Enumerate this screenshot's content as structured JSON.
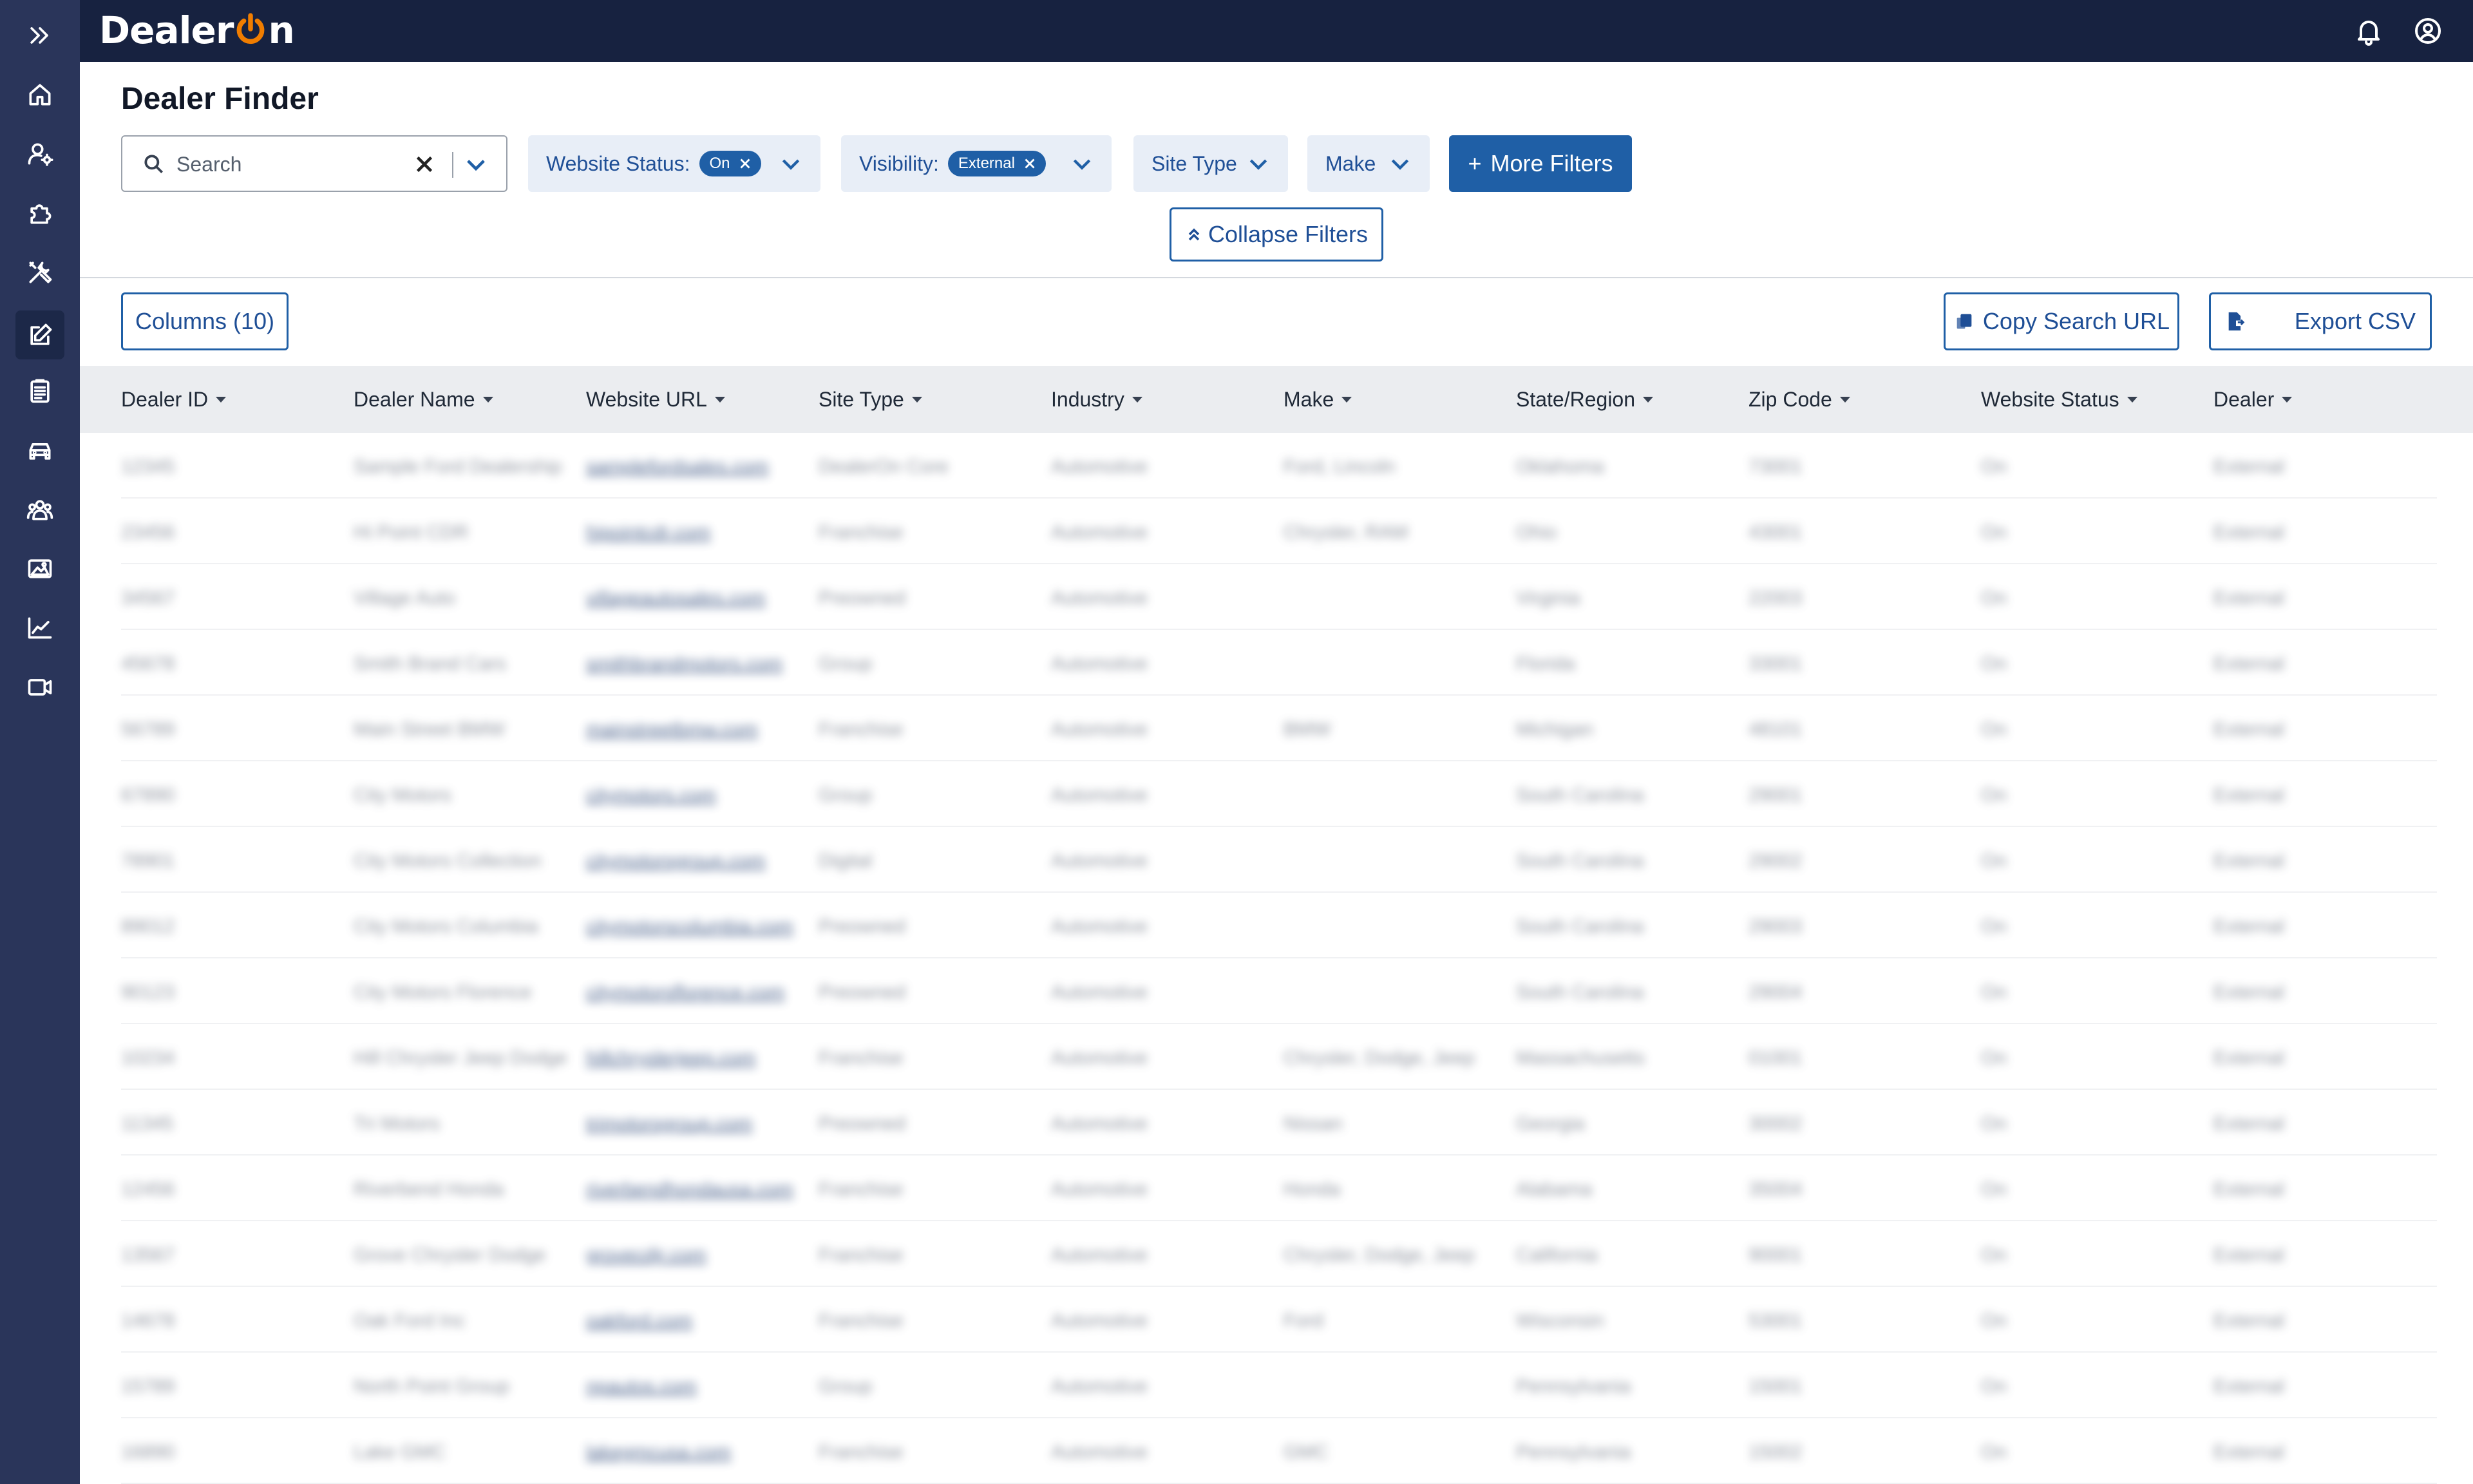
{
  "app": {
    "logo_text_1": "Dealer",
    "logo_text_2": "n",
    "colors": {
      "sidebar": "#2a355a",
      "topbar": "#172240",
      "accent": "#f07d00",
      "primary": "#1f5fa6"
    }
  },
  "sidebar": {
    "items": [
      {
        "icon": "expand-icon"
      },
      {
        "icon": "home-icon"
      },
      {
        "icon": "user-settings-icon"
      },
      {
        "icon": "puzzle-icon"
      },
      {
        "icon": "tools-icon"
      },
      {
        "icon": "edit-icon",
        "active": true
      },
      {
        "icon": "clipboard-icon"
      },
      {
        "icon": "car-icon"
      },
      {
        "icon": "users-icon"
      },
      {
        "icon": "image-icon"
      },
      {
        "icon": "chart-icon"
      },
      {
        "icon": "video-icon"
      }
    ]
  },
  "page": {
    "title": "Dealer Finder"
  },
  "filters": {
    "search_placeholder": "Search",
    "website_status": {
      "label": "Website Status:",
      "chip": "On"
    },
    "visibility": {
      "label": "Visibility:",
      "chip": "External"
    },
    "site_type": {
      "label": "Site Type"
    },
    "make": {
      "label": "Make"
    },
    "more_filters": "More Filters",
    "collapse_filters": "Collapse Filters"
  },
  "toolbar": {
    "columns": "Columns (10)",
    "copy_search_url": "Copy Search URL",
    "export_csv": "Export CSV"
  },
  "table": {
    "columns": [
      "Dealer ID",
      "Dealer Name",
      "Website URL",
      "Site Type",
      "Industry",
      "Make",
      "State/Region",
      "Zip Code",
      "Website Status",
      "Dealer"
    ],
    "rows": [
      [
        "12345",
        "Sample Ford Dealership",
        "samplefordsales.com",
        "DealerOn Core",
        "Automotive",
        "Ford, Lincoln",
        "Oklahoma",
        "73001",
        "On",
        "External"
      ],
      [
        "23456",
        "Hi Point CDR",
        "hipointcdr.com",
        "Franchise",
        "Automotive",
        "Chrysler, RAM",
        "Ohio",
        "43001",
        "On",
        "External"
      ],
      [
        "34567",
        "Village Auto",
        "villageautosales.com",
        "Preowned",
        "Automotive",
        "",
        "Virginia",
        "22003",
        "On",
        "External"
      ],
      [
        "45678",
        "Smith Brand Cars",
        "smithbrandmotors.com",
        "Group",
        "Automotive",
        "",
        "Florida",
        "33001",
        "On",
        "External"
      ],
      [
        "56789",
        "Main Street BMW",
        "mainstreetbmw.com",
        "Franchise",
        "Automotive",
        "BMW",
        "Michigan",
        "48101",
        "On",
        "External"
      ],
      [
        "67890",
        "City Motors",
        "citymotors.com",
        "Group",
        "Automotive",
        "",
        "South Carolina",
        "29001",
        "On",
        "External"
      ],
      [
        "78901",
        "City Motors Collection",
        "citymotorsgroup.com",
        "Digital",
        "Automotive",
        "",
        "South Carolina",
        "29002",
        "On",
        "External"
      ],
      [
        "89012",
        "City Motors Columbia",
        "citymotorscolumbia.com",
        "Preowned",
        "Automotive",
        "",
        "South Carolina",
        "29003",
        "On",
        "External"
      ],
      [
        "90123",
        "City Motors Florence",
        "citymotorsflorence.com",
        "Preowned",
        "Automotive",
        "",
        "South Carolina",
        "29004",
        "On",
        "External"
      ],
      [
        "10234",
        "Hill Chrysler Jeep Dodge",
        "hillchryslerjeep.com",
        "Franchise",
        "Automotive",
        "Chrysler, Dodge, Jeep",
        "Massachusetts",
        "01001",
        "On",
        "External"
      ],
      [
        "11345",
        "Tri Motors",
        "trimotorsgroup.com",
        "Preowned",
        "Automotive",
        "Nissan",
        "Georgia",
        "30002",
        "On",
        "External"
      ],
      [
        "12456",
        "Riverbend Honda",
        "riverbendhondausa.com",
        "Franchise",
        "Automotive",
        "Honda",
        "Alabama",
        "35004",
        "On",
        "External"
      ],
      [
        "13567",
        "Grove Chrysler Dodge",
        "grovecdjr.com",
        "Franchise",
        "Automotive",
        "Chrysler, Dodge, Jeep",
        "California",
        "90001",
        "On",
        "External"
      ],
      [
        "14678",
        "Oak Ford Inc",
        "oakford.com",
        "Franchise",
        "Automotive",
        "Ford",
        "Wisconsin",
        "53001",
        "On",
        "External"
      ],
      [
        "15789",
        "North Point Group",
        "npautos.com",
        "Group",
        "Automotive",
        "",
        "Pennsylvania",
        "15001",
        "On",
        "External"
      ],
      [
        "16890",
        "Lake GMC",
        "lakegmcusa.com",
        "Franchise",
        "Automotive",
        "GMC",
        "Pennsylvania",
        "15002",
        "On",
        "External"
      ]
    ]
  }
}
